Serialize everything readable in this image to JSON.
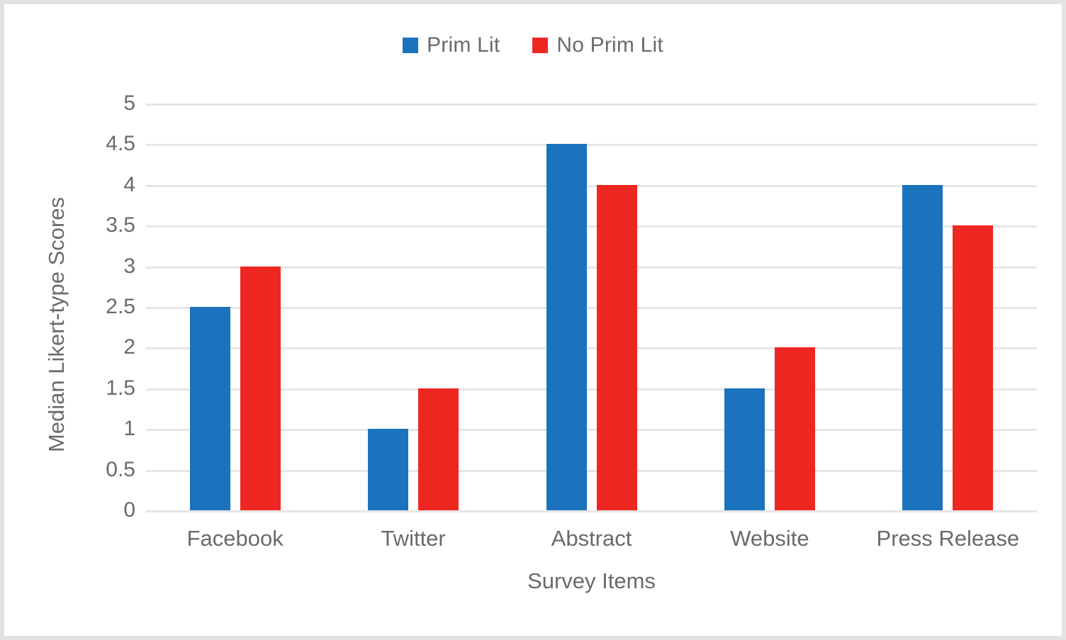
{
  "chart_data": {
    "type": "bar",
    "title": "",
    "subtitle": "",
    "xlabel": "Survey Items",
    "ylabel": "Median Likert-type Scores",
    "categories": [
      "Facebook",
      "Twitter",
      "Abstract",
      "Website",
      "Press Release"
    ],
    "series": [
      {
        "name": "Prim Lit",
        "color": "#1b72bd",
        "values": [
          2.5,
          1,
          4.5,
          1.5,
          4
        ]
      },
      {
        "name": "No Prim Lit",
        "color": "#ee2722",
        "values": [
          3,
          1.5,
          4,
          2,
          3.5
        ]
      }
    ],
    "ylim": [
      0,
      5
    ],
    "ytick_labels": [
      "5",
      "4.5",
      "4",
      "3.5",
      "3",
      "2.5",
      "2",
      "1.5",
      "1",
      "0.5",
      "0"
    ],
    "ytick_values": [
      5,
      4.5,
      4,
      3.5,
      3,
      2.5,
      2,
      1.5,
      1,
      0.5,
      0
    ],
    "grid": "horizontal",
    "legend_position": "top-center",
    "orientation": "vertical",
    "grouping": "grouped"
  },
  "legend": {
    "entries": [
      {
        "label": "Prim Lit",
        "color": "#1b72bd"
      },
      {
        "label": "No Prim Lit",
        "color": "#ee2722"
      }
    ]
  },
  "axes": {
    "x_title": "Survey Items",
    "y_title": "Median Likert-type Scores"
  },
  "colors": {
    "series_blue": "#1b72bd",
    "series_red": "#ee2722",
    "gridline": "#e6e6e6",
    "text": "#6a6a6a",
    "border": "#e3e3e3",
    "background": "#ffffff"
  }
}
